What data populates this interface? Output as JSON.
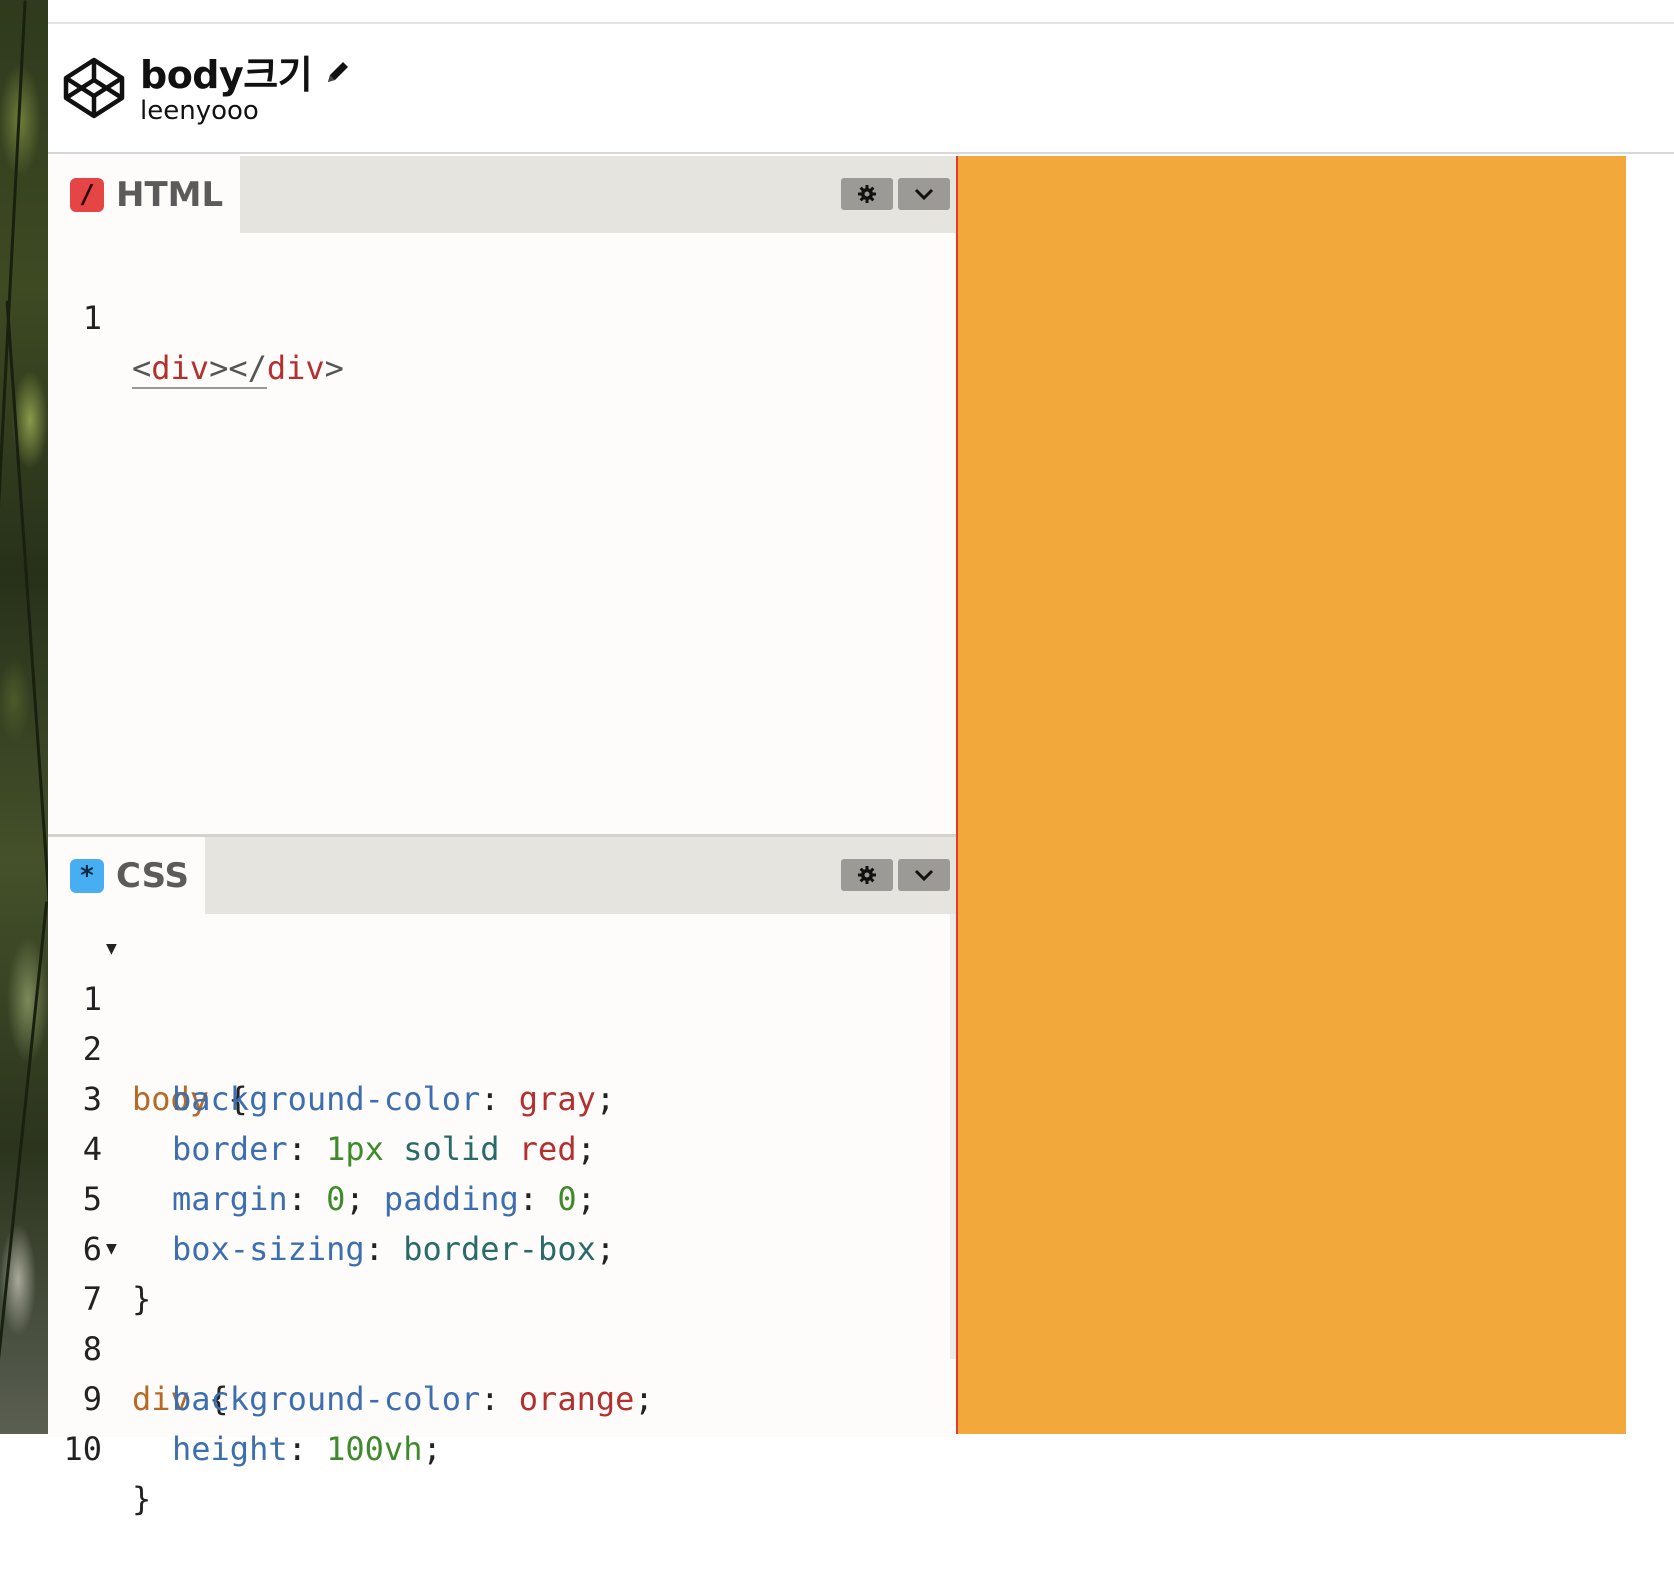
{
  "header": {
    "title": "body크기",
    "author": "leenyooo"
  },
  "html_panel": {
    "label": "HTML",
    "icon": "slash-icon",
    "lines": [
      {
        "num": "1",
        "open": "<",
        "tag1": "div",
        "mid": "></",
        "tag2": "div",
        "close": ">"
      }
    ]
  },
  "css_panel": {
    "label": "CSS",
    "icon": "asterisk-icon",
    "line_numbers": [
      "1",
      "2",
      "3",
      "4",
      "5",
      "6",
      "7",
      "8",
      "9",
      "10"
    ],
    "lines": {
      "l1": {
        "sel": "body",
        "rest": " {"
      },
      "l2": {
        "prop": "background-color",
        "sep": ": ",
        "val": "gray",
        "end": ";"
      },
      "l3": {
        "prop": "border",
        "sep": ": ",
        "num": "1px",
        "kw": " solid ",
        "val": "red",
        "end": ";"
      },
      "l4": {
        "prop": "margin",
        "sep": ": ",
        "num": "0",
        "mid": "; ",
        "prop2": "padding",
        "sep2": ": ",
        "num2": "0",
        "end": ";"
      },
      "l5": {
        "prop": "box-sizing",
        "sep": ": ",
        "kw": "border-box",
        "end": ";"
      },
      "l6": {
        "text": "}"
      },
      "l7": {
        "sel": "div",
        "rest": " {"
      },
      "l8": {
        "prop": "background-color",
        "sep": ": ",
        "val": "orange",
        "end": ";"
      },
      "l9": {
        "prop": "height",
        "sep": ": ",
        "num": "100vh",
        "end": ";"
      },
      "l10": {
        "text": "}"
      }
    }
  },
  "colors": {
    "preview_bg": "#f2a83b",
    "preview_border": "#e03a2a",
    "html_icon": "#e54545",
    "css_icon": "#48aef2"
  }
}
